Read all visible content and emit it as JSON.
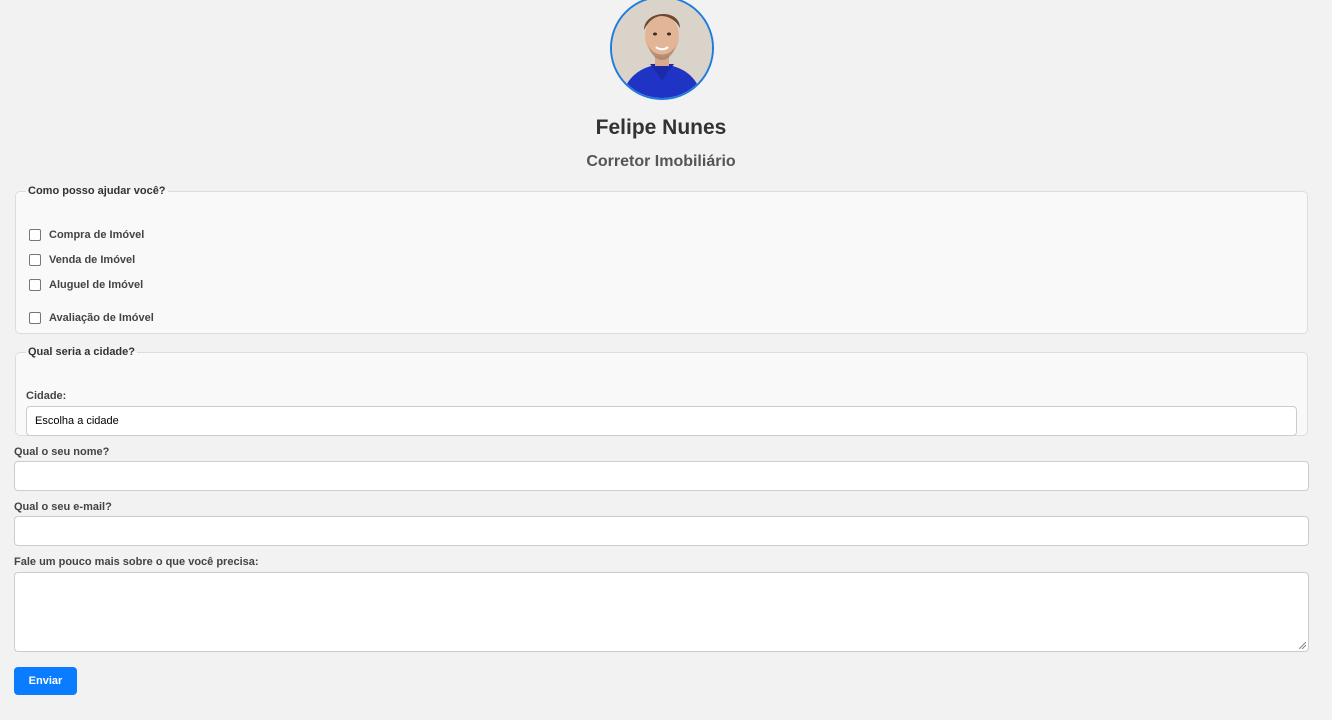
{
  "profile": {
    "name": "Felipe Nunes",
    "role": "Corretor Imobiliário"
  },
  "help_section": {
    "legend": "Como posso ajudar você?",
    "options": [
      {
        "label": "Compra de Imóvel",
        "checked": false
      },
      {
        "label": "Venda de Imóvel",
        "checked": false
      },
      {
        "label": "Aluguel de Imóvel",
        "checked": false
      },
      {
        "label": "Avaliação de Imóvel",
        "checked": false
      }
    ]
  },
  "city_section": {
    "legend": "Qual seria a cidade?",
    "label": "Cidade:",
    "selected": "Escolha a cidade"
  },
  "name_field": {
    "label": "Qual o seu nome?",
    "value": ""
  },
  "email_field": {
    "label": "Qual o seu e-mail?",
    "value": ""
  },
  "message_field": {
    "label": "Fale um pouco mais sobre o que você precisa:",
    "value": ""
  },
  "submit": {
    "label": "Enviar"
  },
  "colors": {
    "accent": "#0a7cff",
    "background": "#f2f2f2"
  }
}
